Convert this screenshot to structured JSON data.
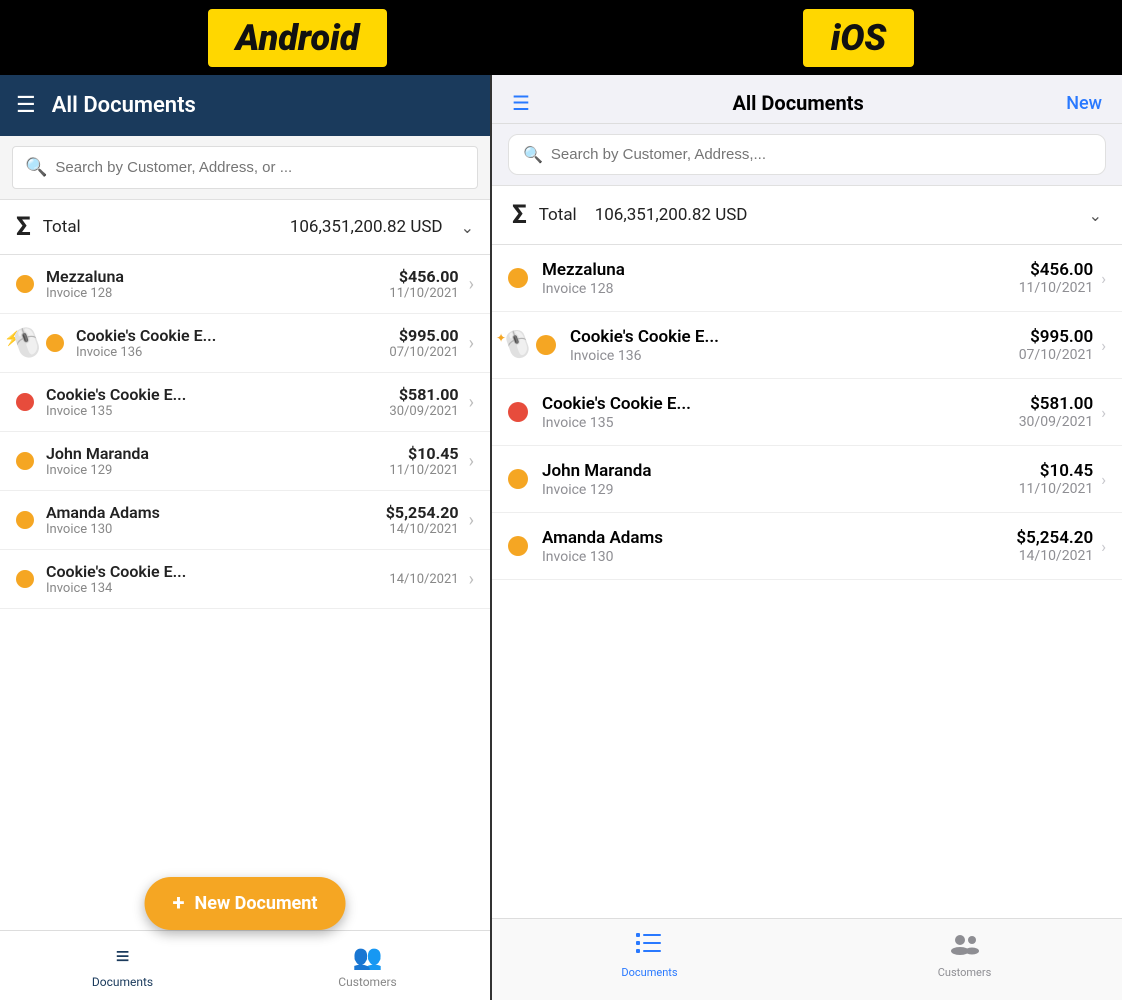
{
  "platforms": {
    "android": "Android",
    "ios": "iOS"
  },
  "android": {
    "header": {
      "title": "All Documents"
    },
    "search": {
      "placeholder": "Search by Customer, Address, or ..."
    },
    "total": {
      "label": "Total",
      "amount": "106,351,200.82 USD"
    },
    "items": [
      {
        "name": "Mezzaluna",
        "sub": "Invoice 128",
        "amount": "$456.00",
        "date": "11/10/2021",
        "dot": "orange",
        "cursor": false
      },
      {
        "name": "Cookie's Cookie E...",
        "sub": "Invoice 136",
        "amount": "$995.00",
        "date": "07/10/2021",
        "dot": "orange",
        "cursor": true
      },
      {
        "name": "Cookie's Cookie E...",
        "sub": "Invoice 135",
        "amount": "$581.00",
        "date": "30/09/2021",
        "dot": "red",
        "cursor": false
      },
      {
        "name": "John Maranda",
        "sub": "Invoice 129",
        "amount": "$10.45",
        "date": "11/10/2021",
        "dot": "orange",
        "cursor": false
      },
      {
        "name": "Amanda Adams",
        "sub": "Invoice 130",
        "amount": "$5,254.20",
        "date": "14/10/2021",
        "dot": "orange",
        "cursor": false
      },
      {
        "name": "Cookie's Cookie E...",
        "sub": "Invoice 134",
        "amount": "",
        "date": "14/10/2021",
        "dot": "orange",
        "cursor": false
      }
    ],
    "fab": {
      "label": "New Document"
    },
    "bottom_nav": [
      {
        "label": "Documents",
        "active": true
      },
      {
        "label": "Customers",
        "active": false
      }
    ]
  },
  "ios": {
    "header": {
      "title": "All Documents",
      "new_label": "New"
    },
    "search": {
      "placeholder": "Search by Customer, Address,..."
    },
    "total": {
      "label": "Total",
      "amount": "106,351,200.82 USD"
    },
    "items": [
      {
        "name": "Mezzaluna",
        "sub": "Invoice 128",
        "amount": "$456.00",
        "date": "11/10/2021",
        "dot": "orange",
        "cursor": false
      },
      {
        "name": "Cookie's Cookie E...",
        "sub": "Invoice 136",
        "amount": "$995.00",
        "date": "07/10/2021",
        "dot": "orange",
        "cursor": true
      },
      {
        "name": "Cookie's Cookie E...",
        "sub": "Invoice 135",
        "amount": "$581.00",
        "date": "30/09/2021",
        "dot": "red",
        "cursor": false
      },
      {
        "name": "John Maranda",
        "sub": "Invoice 129",
        "amount": "$10.45",
        "date": "11/10/2021",
        "dot": "orange",
        "cursor": false
      },
      {
        "name": "Amanda Adams",
        "sub": "Invoice 130",
        "amount": "$5,254.20",
        "date": "14/10/2021",
        "dot": "orange",
        "cursor": false
      }
    ],
    "bottom_nav": [
      {
        "label": "Documents",
        "active": true
      },
      {
        "label": "Customers",
        "active": false
      }
    ]
  }
}
